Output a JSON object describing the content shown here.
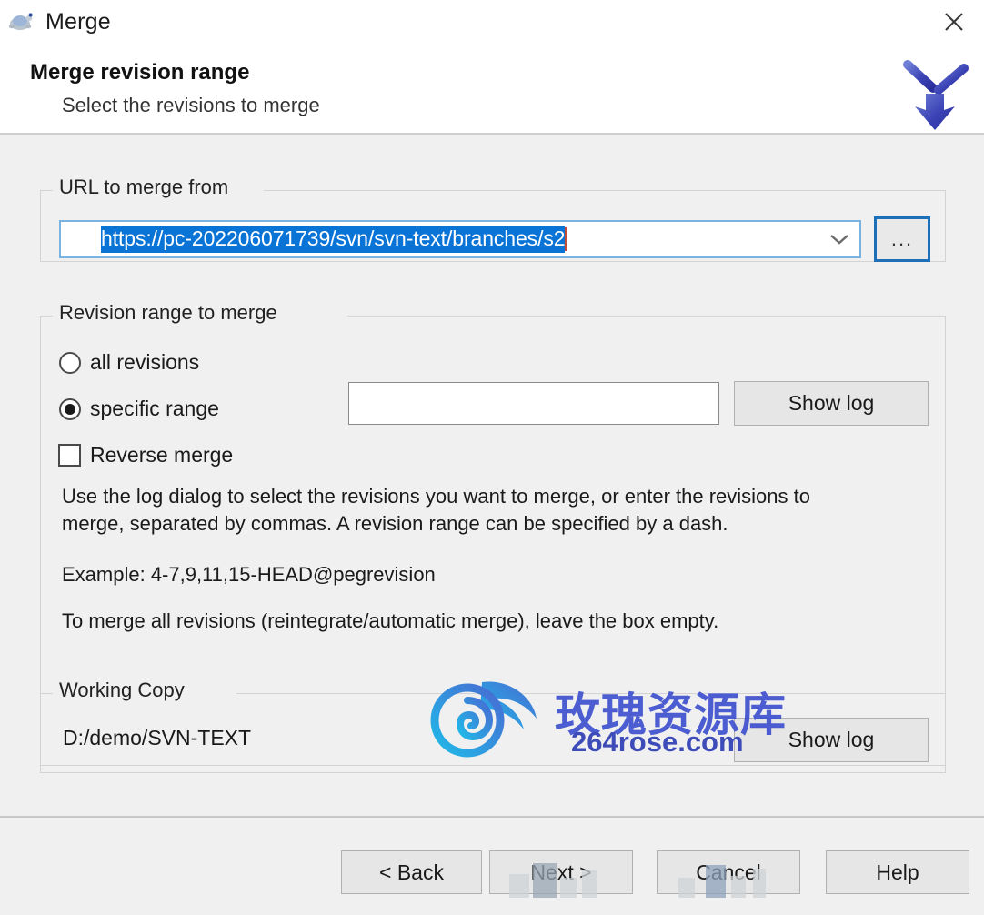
{
  "window": {
    "title": "Merge",
    "app_icon": "tortoise-svn-icon",
    "close_icon": "close-icon"
  },
  "header": {
    "title": "Merge revision range",
    "subtitle": "Select the revisions to merge",
    "logo_icon": "merge-arrow-icon"
  },
  "url_group": {
    "legend": "URL to merge from",
    "value": "https://pc-202206071739/svn/svn-text/branches/s2",
    "selected": true,
    "dropdown_icon": "chevron-down-icon",
    "browse_label": "...",
    "selection_color": "#0a74d6",
    "focus_color": "#1d6fb8"
  },
  "revision_group": {
    "legend": "Revision range to merge",
    "options": [
      {
        "label": "all revisions",
        "checked": false
      },
      {
        "label": "specific range",
        "checked": true
      }
    ],
    "reverse_merge": {
      "label": "Reverse merge",
      "checked": false
    },
    "revision_value": "",
    "revision_placeholder": "",
    "show_log_label": "Show log",
    "description_1": "Use the log dialog to select the revisions you want to merge, or enter the revisions to\nmerge, separated by commas. A revision range can be specified by a dash.",
    "description_2": "Example: 4-7,9,11,15-HEAD@pegrevision",
    "description_3": "To merge all revisions (reintegrate/automatic merge), leave the box empty."
  },
  "working_copy": {
    "legend": "Working Copy",
    "path": "D:/demo/SVN-TEXT",
    "show_log_label": "Show log"
  },
  "footer": {
    "back_label": "< Back",
    "next_label": "Next >",
    "cancel_label": "Cancel",
    "help_label": "Help"
  },
  "watermark": {
    "chinese_text": "玫瑰资源库",
    "url_text": "264rose.com",
    "logo_icon": "rose-logo-icon",
    "color": "#3f51cf"
  }
}
